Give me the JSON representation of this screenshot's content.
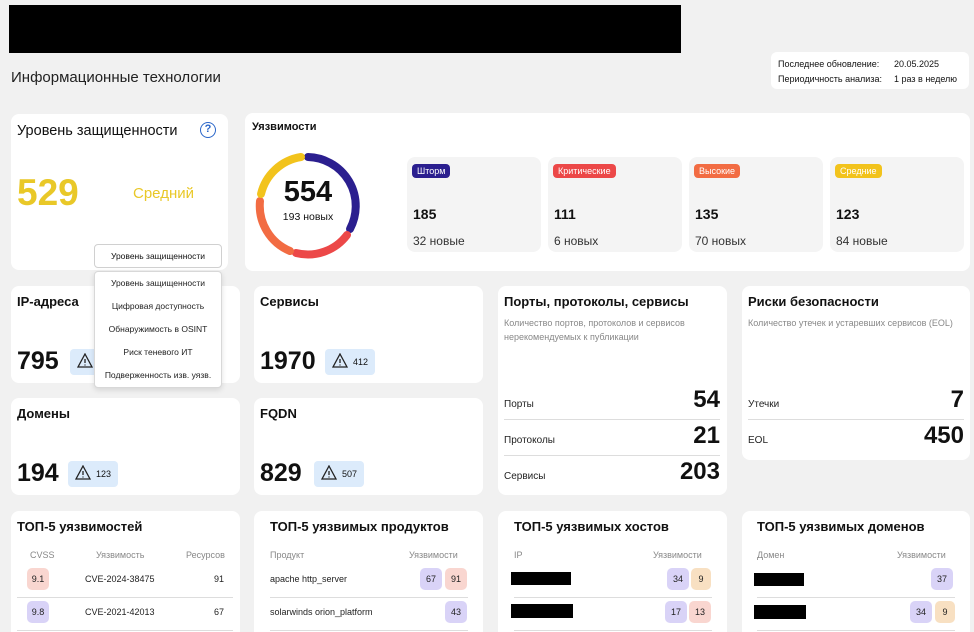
{
  "header": {
    "page_title": "Информационные технологии",
    "last_update_label": "Последнее обновление:",
    "last_update_value": "20.05.2025",
    "period_label": "Периодичность анализа:",
    "period_value": "1 раз в неделю"
  },
  "security_level": {
    "title": "Уровень защищенности",
    "help_icon": "?",
    "score": "529",
    "level": "Средний",
    "dropdown_selected": "Уровень защищенности",
    "dropdown_options": [
      "Уровень защищенности",
      "Цифровая доступность",
      "Обнаружимость в OSINT",
      "Риск теневого ИТ",
      "Подверженность изв. уязв."
    ]
  },
  "vulnerabilities": {
    "title": "Уязвимости",
    "total": "554",
    "total_new": "193 новых",
    "severities": [
      {
        "label": "Шторм",
        "count": "185",
        "new": "32 новые",
        "color": "#2b1f8f"
      },
      {
        "label": "Критические",
        "count": "111",
        "new": "6 новых",
        "color": "#ec4848"
      },
      {
        "label": "Высокие",
        "count": "135",
        "new": "70 новых",
        "color": "#f26c43"
      },
      {
        "label": "Средние",
        "count": "123",
        "new": "84 новые",
        "color": "#f2c31c"
      }
    ]
  },
  "ip": {
    "title": "IP-адреса",
    "value": "795",
    "warn": ""
  },
  "services": {
    "title": "Сервисы",
    "value": "1970",
    "warn": "412"
  },
  "domains": {
    "title": "Домены",
    "value": "194",
    "warn": "123"
  },
  "fqdn": {
    "title": "FQDN",
    "value": "829",
    "warn": "507"
  },
  "ports": {
    "title": "Порты, протоколы, сервисы",
    "desc": "Количество портов, протоколов и сервисов нерекомендуемых к публикации",
    "rows": [
      {
        "k": "Порты",
        "v": "54"
      },
      {
        "k": "Протоколы",
        "v": "21"
      },
      {
        "k": "Сервисы",
        "v": "203"
      }
    ]
  },
  "risks": {
    "title": "Риски безопасности",
    "desc": "Количество утечек и устаревших сервисов (EOL)",
    "rows": [
      {
        "k": "Утечки",
        "v": "7"
      },
      {
        "k": "EOL",
        "v": "450"
      }
    ]
  },
  "top_vulns": {
    "title": "ТОП-5 уязвимостей",
    "cols": [
      "CVSS",
      "Уязвимость",
      "Ресурсов"
    ],
    "rows": [
      {
        "cvss": "9.1",
        "cve": "CVE-2024-38475",
        "res": "91"
      },
      {
        "cvss": "9.8",
        "cve": "CVE-2021-42013",
        "res": "67"
      }
    ]
  },
  "top_products": {
    "title": "ТОП-5 уязвимых продуктов",
    "cols": [
      "Продукт",
      "Уязвимости"
    ],
    "rows": [
      {
        "name": "apache http_server",
        "a": "67",
        "b": "91"
      },
      {
        "name": "solarwinds orion_platform",
        "a": "43",
        "b": ""
      }
    ]
  },
  "top_hosts": {
    "title": "ТОП-5 уязвимых хостов",
    "cols": [
      "IP",
      "Уязвимости"
    ],
    "rows": [
      {
        "a": "34",
        "b": "9"
      },
      {
        "a": "17",
        "b": "13"
      }
    ]
  },
  "top_domains": {
    "title": "ТОП-5 уязвимых доменов",
    "cols": [
      "Домен",
      "Уязвимости"
    ],
    "rows": [
      {
        "a": "37",
        "b": ""
      },
      {
        "a": "34",
        "b": "9"
      }
    ]
  }
}
